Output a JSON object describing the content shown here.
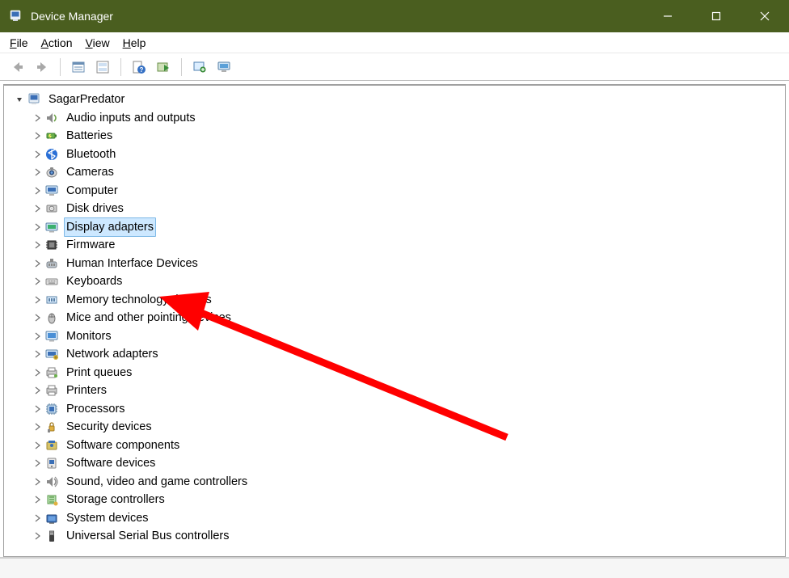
{
  "colors": {
    "titlebar_bg": "#4a5e1f",
    "selection_bg": "#cde8ff",
    "selection_border": "#7fb9e6",
    "annotation": "#ff0000"
  },
  "window": {
    "title": "Device Manager"
  },
  "menubar": {
    "file_acc": "F",
    "file_rest": "ile",
    "action_acc": "A",
    "action_rest": "ction",
    "view_acc": "V",
    "view_rest": "iew",
    "help_acc": "H",
    "help_rest": "elp"
  },
  "toolbar": {
    "back_icon": "back-arrow-icon",
    "forward_icon": "forward-arrow-icon",
    "properties_icon": "properties-icon",
    "refresh_icon": "refresh-icon",
    "help_icon": "help-question-icon",
    "update_icon": "update-driver-icon",
    "scan_icon": "scan-hardware-icon",
    "monitor_icon": "devices-monitor-icon"
  },
  "tree": {
    "root": {
      "label": "SagarPredator",
      "icon": "computer-node-icon",
      "expanded": true
    },
    "items": [
      {
        "label": "Audio inputs and outputs",
        "icon": "audio-icon"
      },
      {
        "label": "Batteries",
        "icon": "battery-icon"
      },
      {
        "label": "Bluetooth",
        "icon": "bluetooth-icon"
      },
      {
        "label": "Cameras",
        "icon": "camera-icon"
      },
      {
        "label": "Computer",
        "icon": "computer-icon"
      },
      {
        "label": "Disk drives",
        "icon": "disk-icon"
      },
      {
        "label": "Display adapters",
        "icon": "display-adapter-icon",
        "selected": true
      },
      {
        "label": "Firmware",
        "icon": "firmware-icon"
      },
      {
        "label": "Human Interface Devices",
        "icon": "hid-icon"
      },
      {
        "label": "Keyboards",
        "icon": "keyboard-icon"
      },
      {
        "label": "Memory technology devices",
        "icon": "memory-icon"
      },
      {
        "label": "Mice and other pointing devices",
        "icon": "mouse-icon"
      },
      {
        "label": "Monitors",
        "icon": "monitor-icon"
      },
      {
        "label": "Network adapters",
        "icon": "network-icon"
      },
      {
        "label": "Print queues",
        "icon": "print-queues-icon"
      },
      {
        "label": "Printers",
        "icon": "printer-icon"
      },
      {
        "label": "Processors",
        "icon": "processor-icon"
      },
      {
        "label": "Security devices",
        "icon": "security-icon"
      },
      {
        "label": "Software components",
        "icon": "software-components-icon"
      },
      {
        "label": "Software devices",
        "icon": "software-devices-icon"
      },
      {
        "label": "Sound, video and game controllers",
        "icon": "sound-video-icon"
      },
      {
        "label": "Storage controllers",
        "icon": "storage-controller-icon"
      },
      {
        "label": "System devices",
        "icon": "system-devices-icon"
      },
      {
        "label": "Universal Serial Bus controllers",
        "icon": "usb-icon"
      }
    ]
  }
}
